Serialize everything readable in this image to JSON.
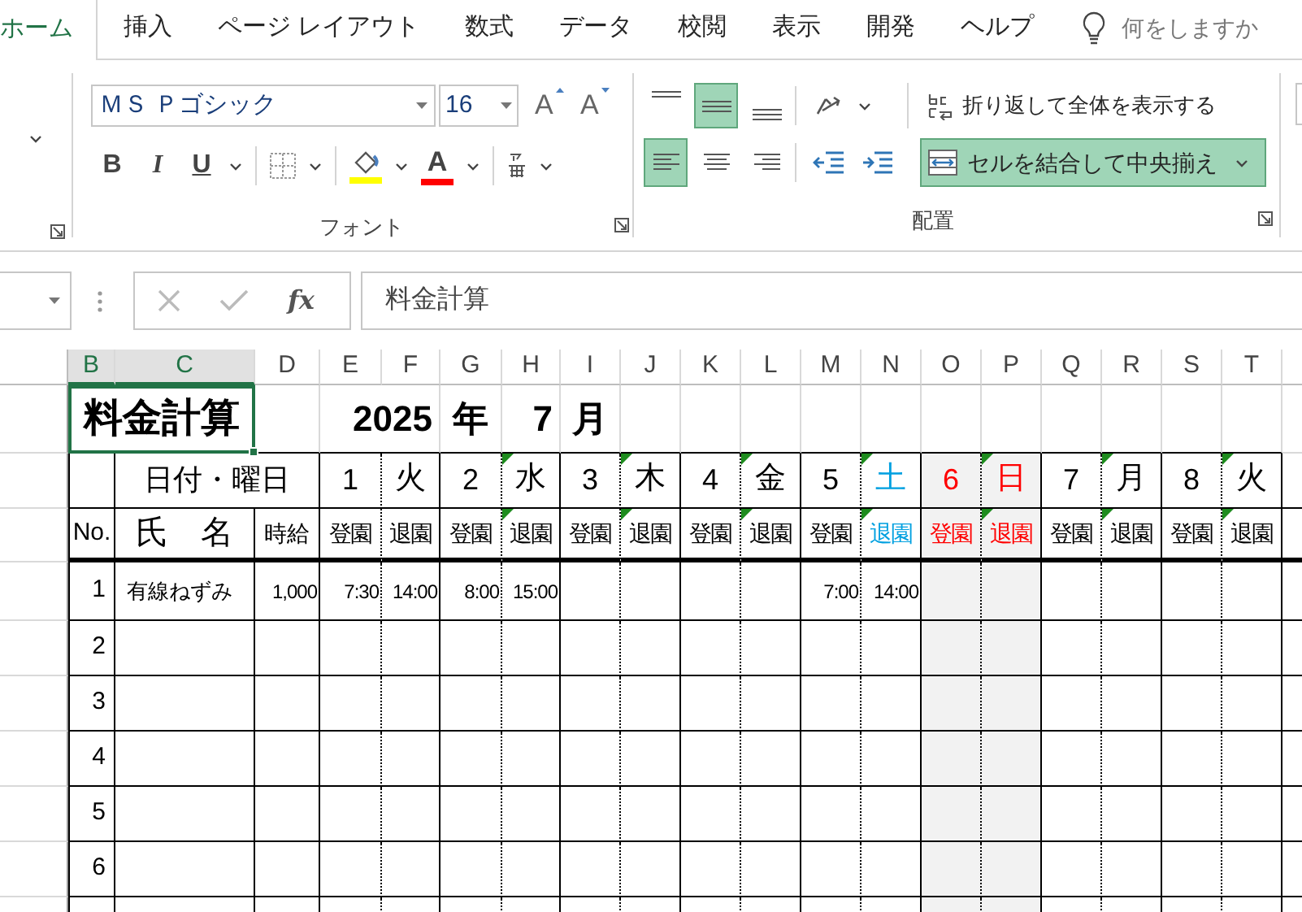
{
  "ribbon_tabs": [
    {
      "label": "ホーム",
      "selected": true
    },
    {
      "label": "挿入",
      "selected": false
    },
    {
      "label": "ページ レイアウト",
      "selected": false
    },
    {
      "label": "数式",
      "selected": false
    },
    {
      "label": "データ",
      "selected": false
    },
    {
      "label": "校閲",
      "selected": false
    },
    {
      "label": "表示",
      "selected": false
    },
    {
      "label": "開発",
      "selected": false
    },
    {
      "label": "ヘルプ",
      "selected": false
    }
  ],
  "tell_me": {
    "placeholder": "何をしますか"
  },
  "font_group": {
    "label": "フォント",
    "font_name": "ＭＳ Ｐゴシック",
    "font_size": "16",
    "grow_label": "A",
    "shrink_label": "A",
    "bold_label": "B",
    "italic_label": "I",
    "underline_label": "U",
    "font_color_label": "A"
  },
  "alignment_group": {
    "label": "配置",
    "vertical_align": [
      {
        "kind": "top",
        "selected": false
      },
      {
        "kind": "middle",
        "selected": true
      },
      {
        "kind": "bottom",
        "selected": false
      }
    ],
    "horizontal_align": [
      {
        "kind": "left",
        "selected": true
      },
      {
        "kind": "center",
        "selected": false
      },
      {
        "kind": "right",
        "selected": false
      }
    ],
    "wrap_text": {
      "label": "折り返して全体を表示する",
      "selected": false
    },
    "merge_center": {
      "label": "セルを結合して中央揃え",
      "selected": true
    }
  },
  "formula_bar": {
    "function_label": "fx",
    "content": "料金計算"
  },
  "sheet": {
    "column_headers": [
      {
        "label": "B",
        "selected": true
      },
      {
        "label": "C",
        "selected": true
      },
      {
        "label": "D",
        "selected": false
      },
      {
        "label": "E",
        "selected": false
      },
      {
        "label": "F",
        "selected": false
      },
      {
        "label": "G",
        "selected": false
      },
      {
        "label": "H",
        "selected": false
      },
      {
        "label": "I",
        "selected": false
      },
      {
        "label": "J",
        "selected": false
      },
      {
        "label": "K",
        "selected": false
      },
      {
        "label": "L",
        "selected": false
      },
      {
        "label": "M",
        "selected": false
      },
      {
        "label": "N",
        "selected": false
      },
      {
        "label": "O",
        "selected": false
      },
      {
        "label": "P",
        "selected": false
      },
      {
        "label": "Q",
        "selected": false
      },
      {
        "label": "R",
        "selected": false
      },
      {
        "label": "S",
        "selected": false
      },
      {
        "label": "T",
        "selected": false
      }
    ],
    "title": "料金計算",
    "year": "2025",
    "year_unit": "年",
    "month": "7",
    "month_unit": "月",
    "date_header": "日付・曜日",
    "no_header": "No.",
    "name_header": "氏　名",
    "wage_header": "時給",
    "days": [
      {
        "date": "1",
        "weekday": "火",
        "kind": "weekday",
        "comment": false,
        "in_label": "登園",
        "out_label": "退園"
      },
      {
        "date": "2",
        "weekday": "水",
        "kind": "weekday",
        "comment": true,
        "in_label": "登園",
        "out_label": "退園"
      },
      {
        "date": "3",
        "weekday": "木",
        "kind": "weekday",
        "comment": true,
        "in_label": "登園",
        "out_label": "退園"
      },
      {
        "date": "4",
        "weekday": "金",
        "kind": "weekday",
        "comment": true,
        "in_label": "登園",
        "out_label": "退園"
      },
      {
        "date": "5",
        "weekday": "土",
        "kind": "saturday",
        "comment": true,
        "in_label": "登園",
        "out_label": "退園"
      },
      {
        "date": "6",
        "weekday": "日",
        "kind": "sunday",
        "comment": true,
        "in_label": "登園",
        "out_label": "退園"
      },
      {
        "date": "7",
        "weekday": "月",
        "kind": "weekday",
        "comment": true,
        "in_label": "登園",
        "out_label": "退園"
      },
      {
        "date": "8",
        "weekday": "火",
        "kind": "weekday",
        "comment": true,
        "in_label": "登園",
        "out_label": "退園"
      }
    ],
    "rows": [
      {
        "no": "1",
        "name": "有線ねずみ",
        "wage": "1,000",
        "times": {
          "day_1": {
            "in": "7:30",
            "out": "14:00"
          },
          "day_2": {
            "in": "8:00",
            "out": "15:00"
          },
          "day_5": {
            "in": "7:00",
            "out": "14:00"
          }
        }
      },
      {
        "no": "2"
      },
      {
        "no": "3"
      },
      {
        "no": "4"
      },
      {
        "no": "5"
      },
      {
        "no": "6"
      }
    ]
  }
}
